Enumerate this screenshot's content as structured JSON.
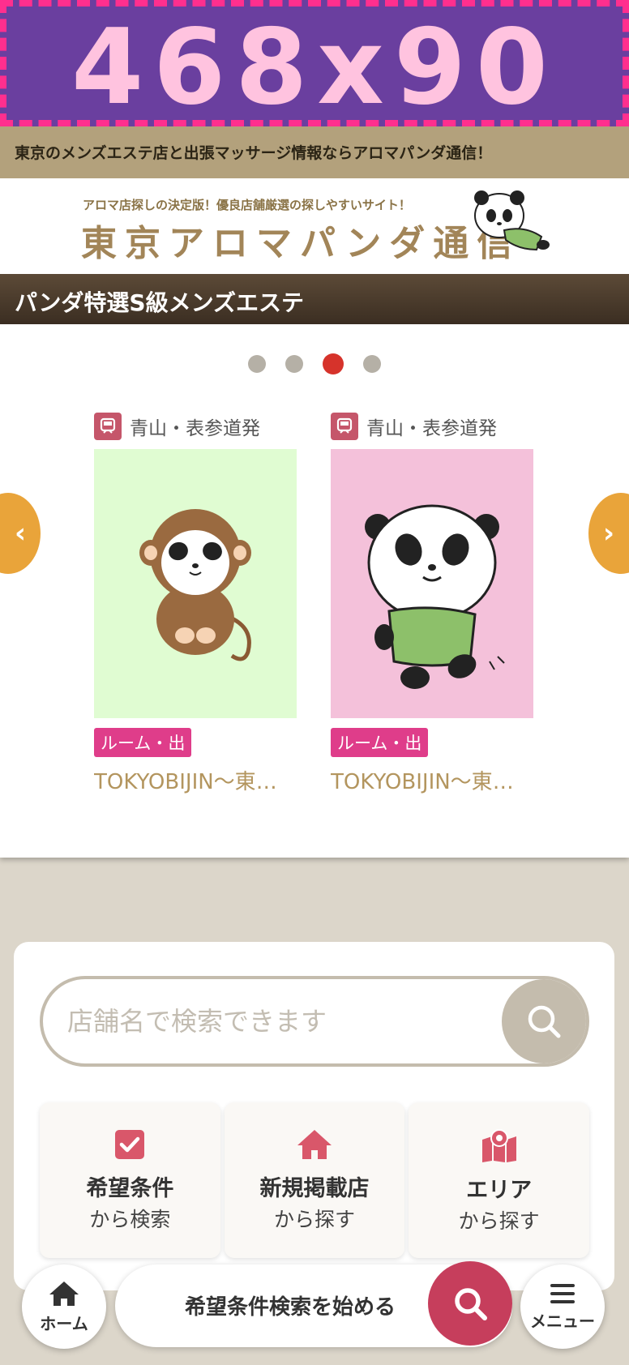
{
  "ad_banner": {
    "text": "468x90"
  },
  "tagline": "東京のメンズエステ店と出張マッサージ情報ならアロマパンダ通信！",
  "logo": {
    "subtitle": "アロマ店探しの決定版！優良店舗厳選の探しやすいサイト！",
    "title": "東京アロマパンダ通信"
  },
  "section_title": "パンダ特選S級メンズエステ",
  "carousel": {
    "dots": 4,
    "active_dot": 3,
    "shops": [
      {
        "station": "青山・表参道発",
        "badge": "ルーム・出",
        "name": "TOKYOBIJIN〜東京美人〜",
        "image": "monkey-mascot",
        "bg": "#e0fcd2"
      },
      {
        "station": "青山・表参道発",
        "badge": "ルーム・出",
        "name": "TOKYOBIJIN〜東京美人〜",
        "image": "panda-mascot",
        "bg": "#f4c1da"
      }
    ]
  },
  "search": {
    "placeholder": "店舗名で検索できます",
    "tiles": [
      {
        "title": "希望条件",
        "sub": "から検索",
        "icon": "checkbox-icon"
      },
      {
        "title": "新規掲載店",
        "sub": "から探す",
        "icon": "home-icon"
      },
      {
        "title": "エリア",
        "sub": "から探す",
        "icon": "map-pin-icon"
      }
    ]
  },
  "bottom_bar": {
    "home_label": "ホーム",
    "start_search_label": "希望条件検索を始める",
    "menu_label": "メニュー"
  },
  "colors": {
    "accent_orange": "#e9a43a",
    "accent_red": "#c63e5c",
    "badge_pink": "#df3d8a",
    "brand_gold": "#b3955e"
  }
}
